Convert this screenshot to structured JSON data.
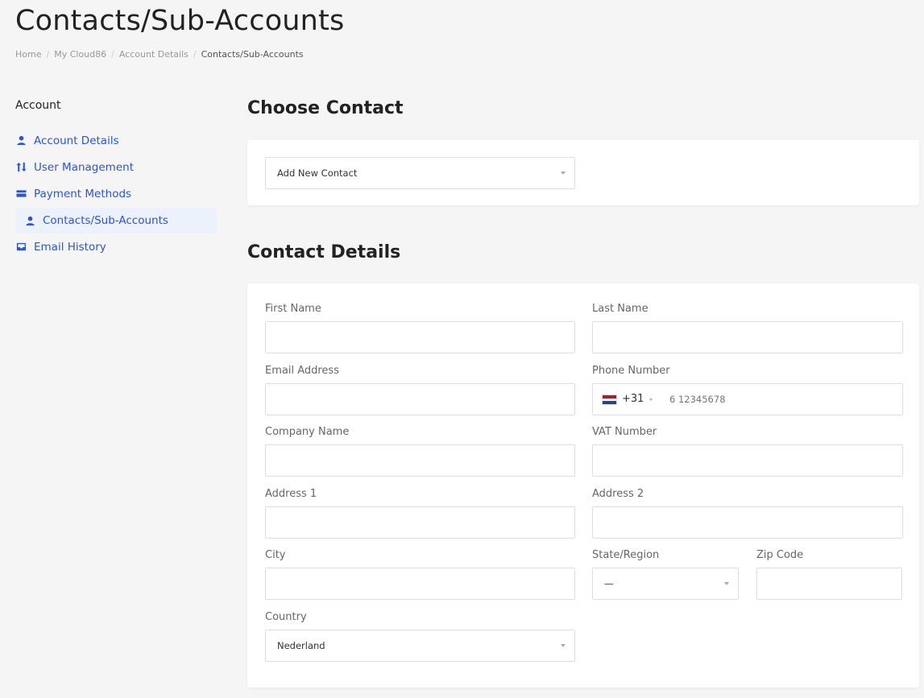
{
  "page": {
    "title": "Contacts/Sub-Accounts"
  },
  "breadcrumb": [
    "Home",
    "My Cloud86",
    "Account Details",
    "Contacts/Sub-Accounts"
  ],
  "sidebar": {
    "heading": "Account",
    "items": [
      {
        "label": "Account Details",
        "icon": "user-icon",
        "active": false
      },
      {
        "label": "User Management",
        "icon": "sort-arrows-icon",
        "active": false
      },
      {
        "label": "Payment Methods",
        "icon": "credit-card-icon",
        "active": false
      },
      {
        "label": "Contacts/Sub-Accounts",
        "icon": "user-icon",
        "active": true
      },
      {
        "label": "Email History",
        "icon": "inbox-icon",
        "active": false
      }
    ]
  },
  "choose_contact": {
    "title": "Choose Contact",
    "selected": "Add New Contact"
  },
  "contact_details": {
    "title": "Contact Details",
    "fields": {
      "first_name": {
        "label": "First Name",
        "value": ""
      },
      "last_name": {
        "label": "Last Name",
        "value": ""
      },
      "email": {
        "label": "Email Address",
        "value": ""
      },
      "phone": {
        "label": "Phone Number",
        "dial_code": "+31",
        "placeholder": "6 12345678",
        "flag": "netherlands-flag-icon"
      },
      "company": {
        "label": "Company Name",
        "value": ""
      },
      "vat": {
        "label": "VAT Number",
        "value": ""
      },
      "address1": {
        "label": "Address 1",
        "value": ""
      },
      "address2": {
        "label": "Address 2",
        "value": ""
      },
      "city": {
        "label": "City",
        "value": ""
      },
      "state": {
        "label": "State/Region",
        "selected": "—"
      },
      "zip": {
        "label": "Zip Code",
        "value": ""
      },
      "country": {
        "label": "Country",
        "selected": "Nederland"
      }
    }
  },
  "colors": {
    "accent": "#2a54d9",
    "active_bg": "#ecf1fb",
    "page_bg": "#f5f5f5"
  }
}
